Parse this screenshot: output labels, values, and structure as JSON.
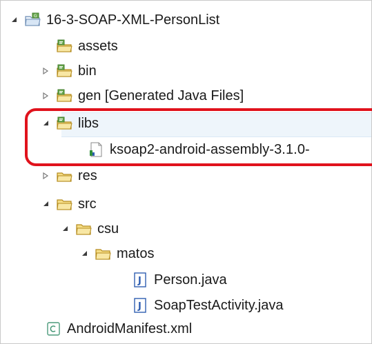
{
  "tree": {
    "project": {
      "label": "16-3-SOAP-XML-PersonList",
      "icon": "android-project-icon",
      "state": "expanded"
    },
    "items": [
      {
        "label": "assets",
        "icon": "source-folder-icon",
        "state": "none"
      },
      {
        "label": "bin",
        "icon": "source-folder-icon",
        "state": "collapsed"
      },
      {
        "label": "gen [Generated Java Files]",
        "icon": "source-folder-icon",
        "state": "collapsed"
      },
      {
        "label": "libs",
        "icon": "source-folder-icon",
        "state": "expanded"
      },
      {
        "label": "ksoap2-android-assembly-3.1.0-",
        "icon": "jar-file-icon",
        "state": "none"
      },
      {
        "label": "res",
        "icon": "source-folder-icon",
        "state": "collapsed"
      },
      {
        "label": "src",
        "icon": "folder-icon",
        "state": "expanded"
      },
      {
        "label": "csu",
        "icon": "package-folder-icon",
        "state": "expanded"
      },
      {
        "label": "matos",
        "icon": "package-folder-icon",
        "state": "expanded"
      },
      {
        "label": "Person.java",
        "icon": "java-file-icon",
        "state": "none"
      },
      {
        "label": "SoapTestActivity.java",
        "icon": "java-file-icon",
        "state": "none"
      },
      {
        "label": "AndroidManifest.xml",
        "icon": "manifest-file-icon",
        "state": "none"
      }
    ]
  },
  "colors": {
    "highlight_border": "#e0121c",
    "folder_fill": "#f5dd86",
    "folder_stroke": "#b58b1d",
    "source_badge": "#6aa84f",
    "java_icon": "#2f5eb1"
  }
}
